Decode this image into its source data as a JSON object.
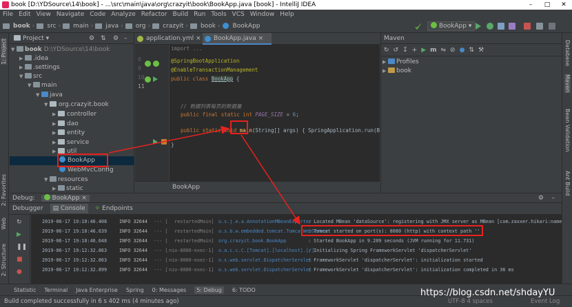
{
  "titlebar": {
    "title": "book [D:\\YDSource\\14\\book] - ...\\src\\main\\java\\org\\crazyit\\book\\BookApp.java [book] - IntelliJ IDEA"
  },
  "menu": [
    "File",
    "Edit",
    "View",
    "Navigate",
    "Code",
    "Analyze",
    "Refactor",
    "Build",
    "Run",
    "Tools",
    "VCS",
    "Window",
    "Help"
  ],
  "breadcrumb_nav": [
    "book",
    "src",
    "main",
    "java",
    "org",
    "crazyit",
    "book",
    "BookApp"
  ],
  "run_config": "BookApp",
  "project": {
    "header": "Project",
    "items": [
      {
        "label": "book",
        "extra": "D:\\YDSource\\14\\book"
      },
      {
        "label": ".idea"
      },
      {
        "label": ".settings"
      },
      {
        "label": "src"
      },
      {
        "label": "main"
      },
      {
        "label": "java"
      },
      {
        "label": "org.crazyit.book"
      },
      {
        "label": "controller"
      },
      {
        "label": "dao"
      },
      {
        "label": "entity"
      },
      {
        "label": "service"
      },
      {
        "label": "util"
      },
      {
        "label": "BookApp"
      },
      {
        "label": "WebMvcConfig"
      },
      {
        "label": "resources"
      },
      {
        "label": "static"
      }
    ]
  },
  "editor": {
    "tabs": [
      "application.yml",
      "BookApp.java"
    ],
    "line_numbers": [
      "8",
      "9",
      "10",
      "11",
      "12",
      "13",
      "14",
      "15",
      "16",
      "17",
      "18"
    ],
    "code": {
      "import_line": "import ...",
      "ann1": "@SpringBootApplication",
      "ann2": "@EnableTransactionManagement",
      "class_kw": "public class ",
      "class_name": "BookApp",
      "class_brace": " {",
      "comment": "// 数据列表每页的数据量",
      "field_kw": "public final static int ",
      "field_name": "PAGE_SIZE",
      "field_eq": " = ",
      "field_val": "6",
      "field_end": ";",
      "main_kw": "public static void ",
      "main_name": "main",
      "main_rest": "(String[] args) { SpringApplication.run(BookApp.cla",
      "close": "}"
    },
    "breadcrumb": "BookApp"
  },
  "maven": {
    "header": "Maven",
    "items": [
      "Profiles",
      "book"
    ]
  },
  "debug": {
    "header": "Debug:",
    "config": "BookApp",
    "tabs": [
      "Debugger",
      "Console",
      "Endpoints"
    ],
    "log": [
      {
        "date": "2019-06-17 19:10:46.408",
        "level": "INFO 32644",
        "sep": "--- [",
        "thread": "  restartedMain]",
        "logger": "o.s.j.e.a.AnnotationMBeanExporter",
        "msg": ": Located MBean 'dataSource': registering with JMX server as MBean [com.zaxxer.hikari:name=data"
      },
      {
        "date": "2019-06-17 19:10:46.639",
        "level": "INFO 32644",
        "sep": "--- [",
        "thread": "  restartedMain]",
        "logger": "o.s.b.w.embedded.tomcat.TomcatWebServer",
        "msg": ": Tomcat started on port(s): 8080 (http) with context path ''"
      },
      {
        "date": "2019-06-17 19:10:46.648",
        "level": "INFO 32644",
        "sep": "--- [",
        "thread": "  restartedMain]",
        "logger": "org.crazyit.book.BookApp",
        "msg": ": Started BookApp in 9.209 seconds (JVM running for 11.731)"
      },
      {
        "date": "2019-06-17 19:12:32.863",
        "level": "INFO 32644",
        "sep": "--- [",
        "thread": "nio-8080-exec-1]",
        "logger": "o.a.c.c.C.[Tomcat].[localhost].[/]",
        "msg": ": Initializing Spring FrameworkServlet 'dispatcherServlet'"
      },
      {
        "date": "2019-06-17 19:12:32.863",
        "level": "INFO 32644",
        "sep": "--- [",
        "thread": "nio-8080-exec-1]",
        "logger": "o.s.web.servlet.DispatcherServlet",
        "msg": ": FrameworkServlet 'dispatcherServlet': initialization started"
      },
      {
        "date": "2019-06-17 19:12:32.899",
        "level": "INFO 32644",
        "sep": "--- [",
        "thread": "nio-8080-exec-1]",
        "logger": "o.s.web.servlet.DispatcherServlet",
        "msg": ": FrameworkServlet 'dispatcherServlet': initialization completed in 36 ms"
      }
    ]
  },
  "left_tabs": [
    "1: Project",
    "2: Favorites",
    "Web",
    "2: Structure"
  ],
  "right_tabs": [
    "Database",
    "Maven",
    "Bean Validation",
    "Ant Build"
  ],
  "bottom_tabs": [
    "Statistic",
    "Terminal",
    "Java Enterprise",
    "Spring",
    "0: Messages",
    "5: Debug",
    "6: TODO"
  ],
  "status": "Build completed successfully in 6 s 402 ms (4 minutes ago)",
  "status_right": "Event Log",
  "status_pos": "UTF-8  4 spaces",
  "watermark": "https://blog.csdn.net/shdayYU",
  "colors": {
    "highlight": "#e8221e",
    "accent": "#4a88c7"
  }
}
